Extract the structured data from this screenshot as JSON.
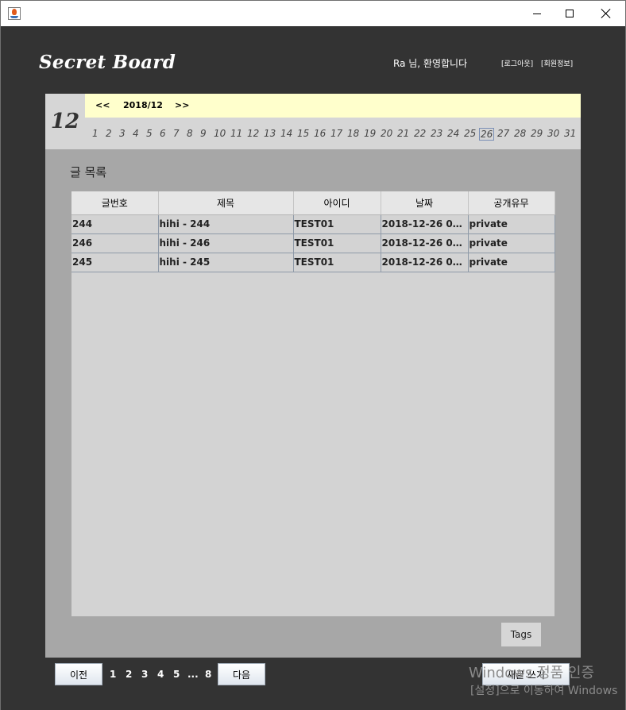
{
  "window": {
    "icon": "java-icon"
  },
  "header": {
    "brand": "Secret Board",
    "welcome": "Ra 님, 환영합니다",
    "logout_link": "[로그아웃]",
    "profile_link": "[회원정보]"
  },
  "calendar": {
    "month_number": "12",
    "prev": "<<",
    "current": "2018/12",
    "next": ">>",
    "days": [
      "1",
      "2",
      "3",
      "4",
      "5",
      "6",
      "7",
      "8",
      "9",
      "10",
      "11",
      "12",
      "13",
      "14",
      "15",
      "16",
      "17",
      "18",
      "19",
      "20",
      "21",
      "22",
      "23",
      "24",
      "25",
      "26",
      "27",
      "28",
      "29",
      "30",
      "31"
    ],
    "selected_day": "26"
  },
  "list": {
    "title": "글 목록",
    "columns": [
      "글번호",
      "제목",
      "아이디",
      "날짜",
      "공개유무"
    ],
    "rows": [
      [
        "244",
        "hihi - 244",
        "TEST01",
        "2018-12-26 00:0...",
        "private"
      ],
      [
        "246",
        "hihi - 246",
        "TEST01",
        "2018-12-26 00:0...",
        "private"
      ],
      [
        "245",
        "hihi - 245",
        "TEST01",
        "2018-12-26 00:0...",
        "private"
      ]
    ]
  },
  "tags_button": "Tags",
  "pagination": {
    "prev": "이전",
    "pages": [
      "1",
      "2",
      "3",
      "4",
      "5",
      "...",
      "8"
    ],
    "next": "다음"
  },
  "write_button": "새글 쓰기",
  "watermark": {
    "line1": "Windows 정품 인증",
    "line2": "[설정]으로 이동하여 Windows"
  },
  "colors": {
    "frame": "#333333",
    "panel": "#a7a7a7",
    "month_nav": "#ffffcc",
    "table_bg": "#d3d3d3"
  }
}
